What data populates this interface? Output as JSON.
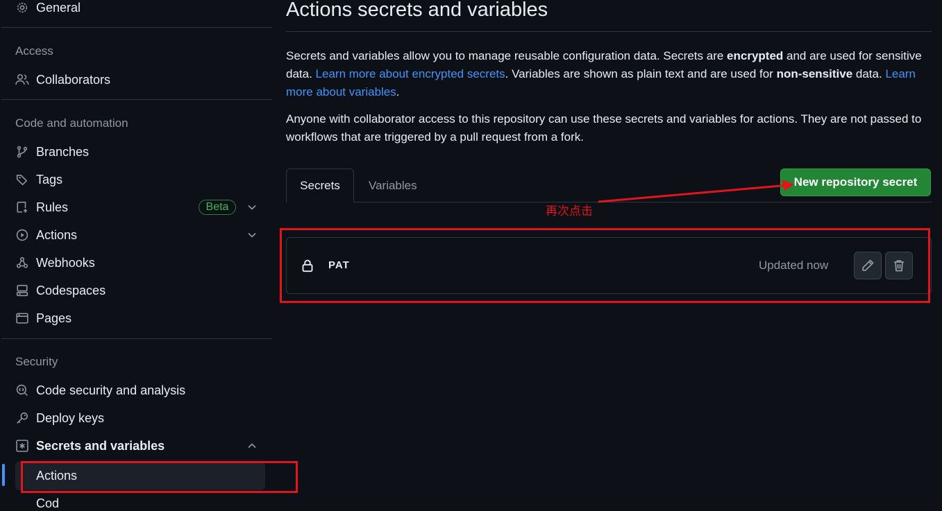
{
  "sidebar": {
    "general": "General",
    "access_title": "Access",
    "collaborators": "Collaborators",
    "code_title": "Code and automation",
    "branches": "Branches",
    "tags": "Tags",
    "rules": "Rules",
    "rules_badge": "Beta",
    "actions": "Actions",
    "webhooks": "Webhooks",
    "codespaces": "Codespaces",
    "pages": "Pages",
    "security_title": "Security",
    "code_security": "Code security and analysis",
    "deploy_keys": "Deploy keys",
    "secrets_vars": "Secrets and variables",
    "sub_actions": "Actions",
    "sub_next": "Cod"
  },
  "main": {
    "title": "Actions secrets and variables",
    "p1_a": "Secrets and variables allow you to manage reusable configuration data. Secrets are ",
    "p1_b": "encrypted",
    "p1_c": " and are used for sensitive data. ",
    "p1_link1": "Learn more about encrypted secrets",
    "p1_d": ". Variables are shown as plain text and are used for ",
    "p1_e": "non-sensitive",
    "p1_f": " data. ",
    "p1_link2": "Learn more about variables",
    "p1_g": ".",
    "p2": "Anyone with collaborator access to this repository can use these secrets and variables for actions. They are not passed to workflows that are triggered by a pull request from a fork.",
    "tabs": [
      "Secrets",
      "Variables"
    ],
    "new_button": "New repository secret",
    "secret": {
      "name": "PAT",
      "status": "Updated now"
    }
  },
  "annotation": {
    "text": "再次点击",
    "color": "#e3141b"
  },
  "colors": {
    "accent": "#4493f8",
    "button_green": "#238636",
    "annotation_red": "#e3141b"
  },
  "icons": [
    "gear-icon",
    "people-icon",
    "git-branch-icon",
    "tag-icon",
    "repo-push-icon",
    "play-icon",
    "webhook-icon",
    "codespaces-icon",
    "browser-icon",
    "codescan-icon",
    "key-icon",
    "asterisk-icon",
    "lock-icon",
    "pencil-icon",
    "trash-icon",
    "chevron-down-icon",
    "chevron-up-icon"
  ]
}
